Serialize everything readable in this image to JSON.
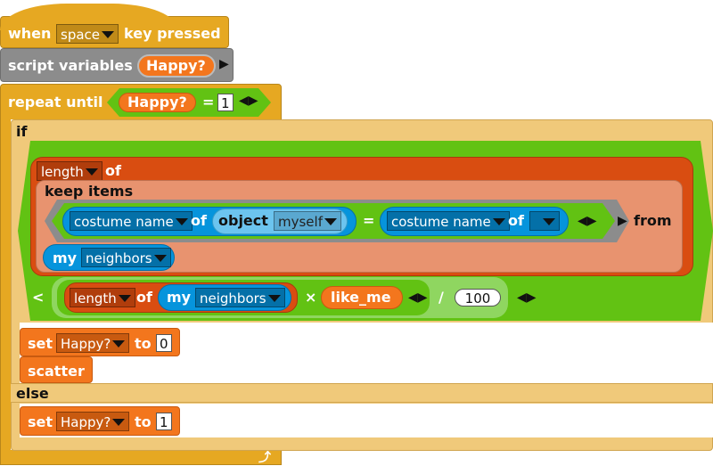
{
  "hat": {
    "when": "when",
    "key": "space",
    "pressed": "key pressed"
  },
  "script_vars": {
    "label": "script variables",
    "var": "Happy?"
  },
  "repeat": {
    "label": "repeat until",
    "var": "Happy?",
    "eq": "=",
    "value": "1"
  },
  "if_block": {
    "if": "if",
    "else": "else"
  },
  "length_of": {
    "attr": "length",
    "of": "of"
  },
  "keep": {
    "label": "keep items",
    "attr": "costume name",
    "of": "of",
    "object": "object",
    "target": "myself",
    "eq": "=",
    "attr2": "costume name",
    "of2": "of",
    "target2": "",
    "from": "from"
  },
  "my_neighbors": {
    "my": "my",
    "what": "neighbors"
  },
  "compare": {
    "lt": "<",
    "attr": "length",
    "of": "of",
    "my": "my",
    "what": "neighbors",
    "times": "×",
    "var": "like_me",
    "div": "/",
    "divisor": "100"
  },
  "set1": {
    "label": "set",
    "var": "Happy?",
    "to": "to",
    "value": "0"
  },
  "scatter": {
    "label": "scatter"
  },
  "set2": {
    "label": "set",
    "var": "Happy?",
    "to": "to",
    "value": "1"
  },
  "colors": {
    "control": "#e6a822",
    "operators": "#62c213",
    "lists": "#d94d11",
    "sensing": "#0694dc",
    "variables": "#f3761d",
    "other": "#8c8c8c"
  }
}
